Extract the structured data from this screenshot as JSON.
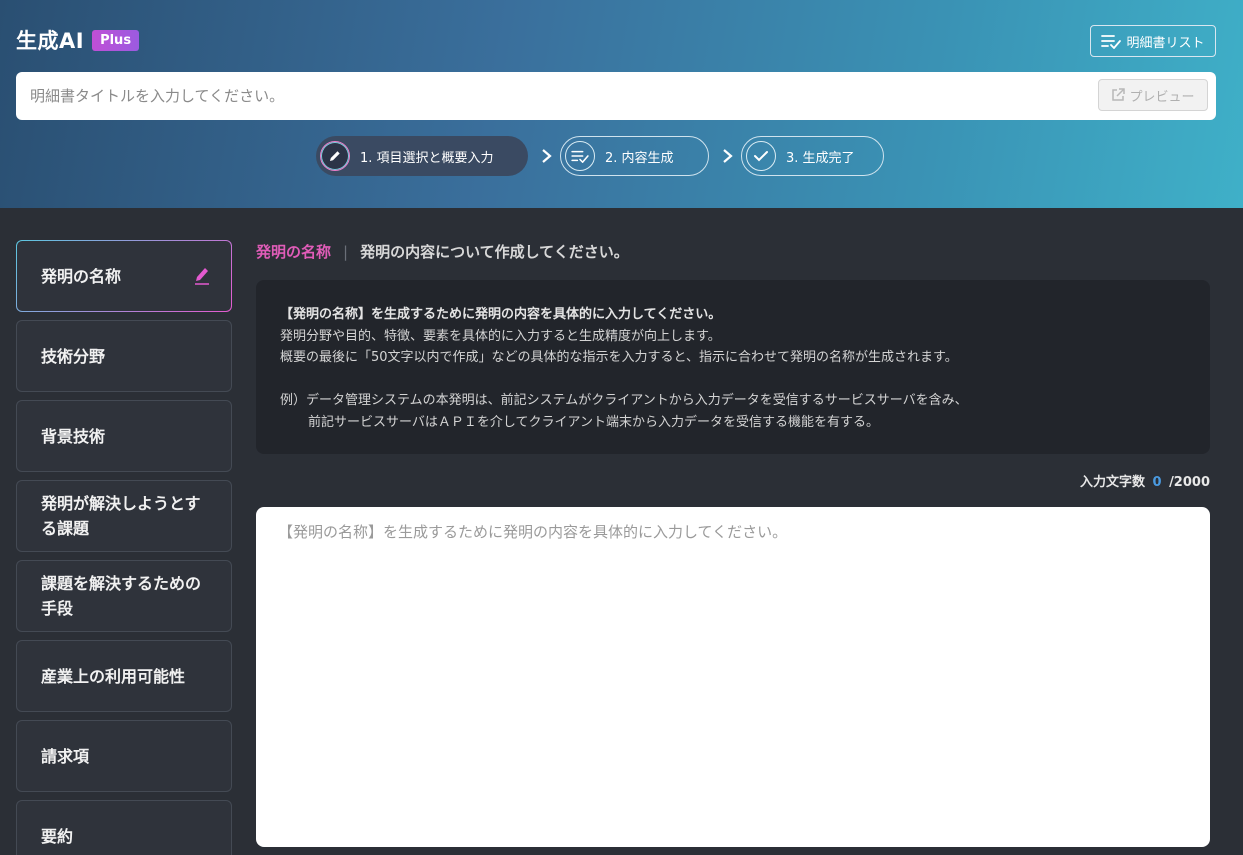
{
  "header": {
    "brand_title": "生成AI",
    "badge": "Plus",
    "spec_list_label": "明細書リスト",
    "title_placeholder": "明細書タイトルを入力してください。",
    "preview_label": "プレビュー"
  },
  "steps": [
    {
      "label": "1. 項目選択と概要入力",
      "icon": "pencil-icon",
      "state": "active"
    },
    {
      "label": "2. 内容生成",
      "icon": "list-check-icon",
      "state": "inactive"
    },
    {
      "label": "3. 生成完了",
      "icon": "check-icon",
      "state": "inactive"
    }
  ],
  "sidebar": {
    "items": [
      {
        "label": "発明の名称",
        "active": true
      },
      {
        "label": "技術分野"
      },
      {
        "label": "背景技術"
      },
      {
        "label": "発明が解決しようとする課題"
      },
      {
        "label": "課題を解決するための手段"
      },
      {
        "label": "産業上の利用可能性"
      },
      {
        "label": "請求項"
      },
      {
        "label": "要約"
      }
    ]
  },
  "main": {
    "section_name": "発明の名称",
    "separator": "|",
    "section_desc": "発明の内容について作成してください。",
    "hint": {
      "line1": "【発明の名称】を生成するために発明の内容を具体的に入力してください。",
      "line2": "発明分野や目的、特徴、要素を具体的に入力すると生成精度が向上します。",
      "line3": "概要の最後に「50文字以内で作成」などの具体的な指示を入力すると、指示に合わせて発明の名称が生成されます。",
      "example1": "例）データ管理システムの本発明は、前記システムがクライアントから入力データを受信するサービスサーバを含み、",
      "example2": "前記サービスサーバはＡＰＩを介してクライアント端末から入力データを受信する機能を有する。"
    },
    "counter_label": "入力文字数",
    "counter_value": "0",
    "counter_max": "/2000",
    "textarea_placeholder": "【発明の名称】を生成するために発明の内容を具体的に入力してください。"
  },
  "colors": {
    "accent_pink": "#e05cb8",
    "count_blue": "#4a9ae0",
    "badge_purple": "#b052dc"
  }
}
